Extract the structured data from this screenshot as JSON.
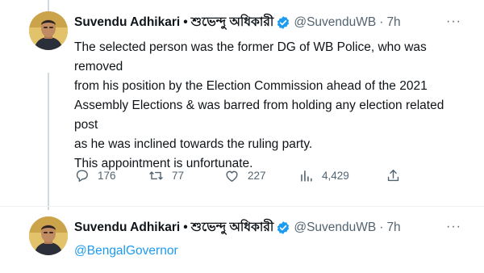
{
  "tweets": [
    {
      "name": "Suvendu Adhikari",
      "bullet": "•",
      "name_bn": "শুভেন্দু অধিকারী",
      "handle": "@SuvenduWB",
      "separator": "·",
      "time": "7h",
      "more": "···",
      "lines": [
        "The selected person was the former DG of WB Police, who was removed",
        "from his position by the Election Commission ahead of the 2021",
        "Assembly Elections & was barred from holding any election related post",
        "as he was inclined towards the ruling party.",
        "This appointment is unfortunate."
      ],
      "stats": {
        "replies": "176",
        "retweets": "77",
        "likes": "227",
        "views": "4,429"
      }
    },
    {
      "name": "Suvendu Adhikari",
      "bullet": "•",
      "name_bn": "শুভেন্দু অধিকারী",
      "handle": "@SuvenduWB",
      "separator": "·",
      "time": "7h",
      "more": "···",
      "mention": "@BengalGovernor"
    }
  ],
  "colors": {
    "accent": "#1d9bf0",
    "muted": "#536471",
    "text": "#0f1419"
  },
  "icons": [
    "avatar",
    "verified-badge-icon",
    "more-icon",
    "reply-icon",
    "retweet-icon",
    "like-icon",
    "views-icon",
    "share-icon"
  ]
}
